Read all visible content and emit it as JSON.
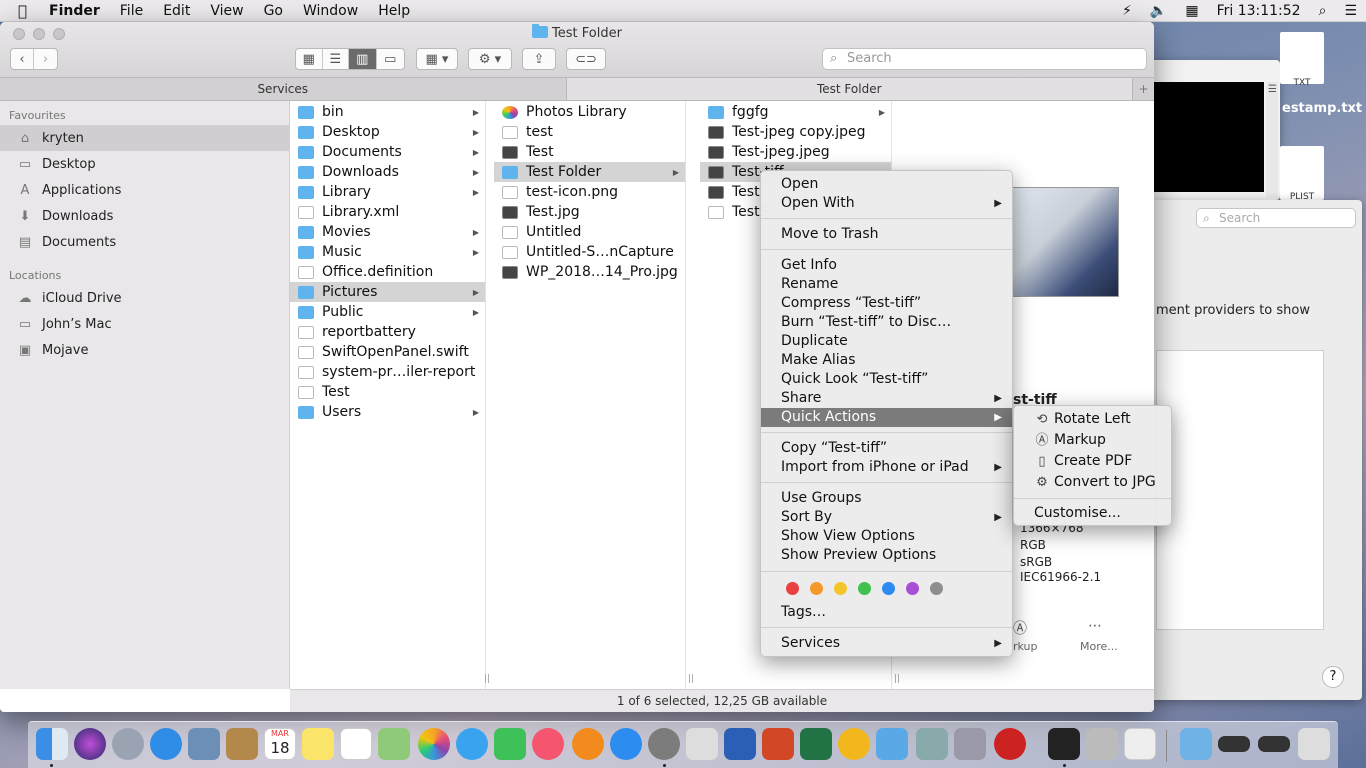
{
  "menubar": {
    "app": "Finder",
    "items": [
      "File",
      "Edit",
      "View",
      "Go",
      "Window",
      "Help"
    ],
    "clock": "Fri 13:11:52"
  },
  "window": {
    "title": "Test Folder",
    "search_placeholder": "Search",
    "tabs": [
      "Services",
      "Test Folder"
    ],
    "status": "1 of 6 selected, 12,25 GB available"
  },
  "sidebar": {
    "favourites_header": "Favourites",
    "favourites": [
      {
        "label": "kryten",
        "icon": "home-icon"
      },
      {
        "label": "Desktop",
        "icon": "desktop-icon"
      },
      {
        "label": "Applications",
        "icon": "applications-icon"
      },
      {
        "label": "Downloads",
        "icon": "downloads-icon"
      },
      {
        "label": "Documents",
        "icon": "documents-icon"
      }
    ],
    "locations_header": "Locations",
    "locations": [
      {
        "label": "iCloud Drive",
        "icon": "cloud-icon"
      },
      {
        "label": "John’s Mac",
        "icon": "computer-icon"
      },
      {
        "label": "Mojave",
        "icon": "disk-icon"
      }
    ]
  },
  "col1": [
    {
      "label": "bin",
      "kind": "folder",
      "arrow": true
    },
    {
      "label": "Desktop",
      "kind": "folder",
      "arrow": true
    },
    {
      "label": "Documents",
      "kind": "folder",
      "arrow": true
    },
    {
      "label": "Downloads",
      "kind": "folder",
      "arrow": true
    },
    {
      "label": "Library",
      "kind": "folder",
      "arrow": true
    },
    {
      "label": "Library.xml",
      "kind": "doc",
      "arrow": false
    },
    {
      "label": "Movies",
      "kind": "folder",
      "arrow": true
    },
    {
      "label": "Music",
      "kind": "folder",
      "arrow": true
    },
    {
      "label": "Office.definition",
      "kind": "doc",
      "arrow": false
    },
    {
      "label": "Pictures",
      "kind": "folder",
      "arrow": true,
      "selected": true
    },
    {
      "label": "Public",
      "kind": "folder",
      "arrow": true
    },
    {
      "label": "reportbattery",
      "kind": "doc",
      "arrow": false
    },
    {
      "label": "SwiftOpenPanel.swift",
      "kind": "doc",
      "arrow": false
    },
    {
      "label": "system-pr…iler-report",
      "kind": "doc",
      "arrow": false
    },
    {
      "label": "Test",
      "kind": "doc",
      "arrow": false
    },
    {
      "label": "Users",
      "kind": "folder",
      "arrow": true
    }
  ],
  "col2": [
    {
      "label": "Photos Library",
      "kind": "photos",
      "arrow": false
    },
    {
      "label": "test",
      "kind": "doc",
      "arrow": false
    },
    {
      "label": "Test",
      "kind": "img",
      "arrow": false
    },
    {
      "label": "Test Folder",
      "kind": "folder",
      "arrow": true,
      "selected": true
    },
    {
      "label": "test-icon.png",
      "kind": "doc",
      "arrow": false
    },
    {
      "label": "Test.jpg",
      "kind": "img",
      "arrow": false
    },
    {
      "label": "Untitled",
      "kind": "doc",
      "arrow": false
    },
    {
      "label": "Untitled-S…nCapture",
      "kind": "doc",
      "arrow": false
    },
    {
      "label": "WP_2018…14_Pro.jpg",
      "kind": "img",
      "arrow": false
    }
  ],
  "col3": [
    {
      "label": "fggfg",
      "kind": "folder",
      "arrow": true
    },
    {
      "label": "Test-jpeg copy.jpeg",
      "kind": "img",
      "arrow": false
    },
    {
      "label": "Test-jpeg.jpeg",
      "kind": "img",
      "arrow": false
    },
    {
      "label": "Test-tiff",
      "kind": "img",
      "arrow": false,
      "selected": true
    },
    {
      "label": "Test-",
      "kind": "img",
      "arrow": false
    },
    {
      "label": "TestS",
      "kind": "doc",
      "arrow": false
    }
  ],
  "preview": {
    "name": "st-tiff",
    "dims": "1366×768",
    "color_model": "RGB",
    "profile": "sRGB",
    "profile2": "IEC61966-2.1",
    "markup": "rkup",
    "more": "More..."
  },
  "bgwin": {
    "search": "Search",
    "text": "ment providers to show",
    "file1": "estamp.txt",
    "txt_label": "TXT",
    "plist_label": "PLIST"
  },
  "context_menu": {
    "items": [
      "Open",
      "Open With",
      "Move to Trash",
      "Get Info",
      "Rename",
      "Compress “Test-tiff”",
      "Burn “Test-tiff” to Disc…",
      "Duplicate",
      "Make Alias",
      "Quick Look “Test-tiff”",
      "Share",
      "Quick Actions",
      "Copy “Test-tiff”",
      "Import from iPhone or iPad",
      "Use Groups",
      "Sort By",
      "Show View Options",
      "Show Preview Options",
      "Tags…",
      "Services"
    ],
    "tag_colors": [
      "#e94040",
      "#f39a2b",
      "#f3c52b",
      "#3ec24d",
      "#2d8cf0",
      "#a74fd6",
      "#8e8e8e"
    ]
  },
  "quick_actions": {
    "items": [
      {
        "label": "Rotate Left",
        "icon": "rotate-left-icon"
      },
      {
        "label": "Markup",
        "icon": "markup-icon"
      },
      {
        "label": "Create PDF",
        "icon": "pdf-icon"
      },
      {
        "label": "Convert to JPG",
        "icon": "gear-icon"
      }
    ],
    "customise": "Customise..."
  },
  "dock": {
    "date_month": "MAR",
    "date_day": "18"
  }
}
